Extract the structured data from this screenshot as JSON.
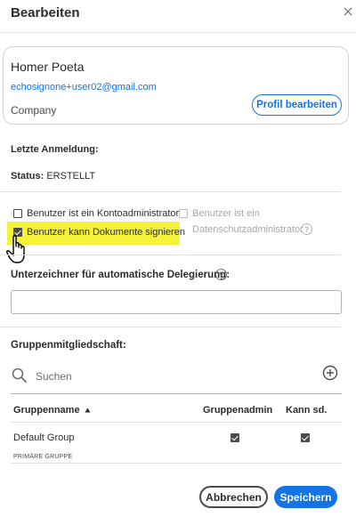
{
  "dialog": {
    "title": "Bearbeiten"
  },
  "profile": {
    "name": "Homer Poeta",
    "email": "echosignone+user02@gmail.com",
    "company": "Company",
    "edit_button": "Profil bearbeiten"
  },
  "info": {
    "last_login_label": "Letzte Anmeldung:",
    "status_label": "Status:",
    "status_value": "ERSTELLT"
  },
  "permissions": {
    "account_admin": {
      "label": "Benutzer ist ein Kontoadministrator",
      "checked": false
    },
    "privacy_admin": {
      "label_line1": "Benutzer ist ein",
      "label_line2": "Datenschutzadministrator",
      "checked": false,
      "disabled": true
    },
    "can_sign": {
      "label": "Benutzer kann Dokumente signieren",
      "checked": true
    }
  },
  "delegation": {
    "label": "Unterzeichner für automatische Delegierung:",
    "value": ""
  },
  "groups": {
    "label": "Gruppenmitgliedschaft:",
    "search_placeholder": "Suchen",
    "columns": {
      "name": "Gruppenname",
      "admin": "Gruppenadmin",
      "can_send": "Kann sd."
    },
    "rows": [
      {
        "name": "Default Group",
        "subtitle": "PRIMÄRE GRUPPE",
        "admin": true,
        "can_send": true
      }
    ]
  },
  "footer": {
    "cancel": "Abbrechen",
    "save": "Speichern"
  },
  "colors": {
    "accent": "#1473e6",
    "highlight": "#f5f23a"
  }
}
